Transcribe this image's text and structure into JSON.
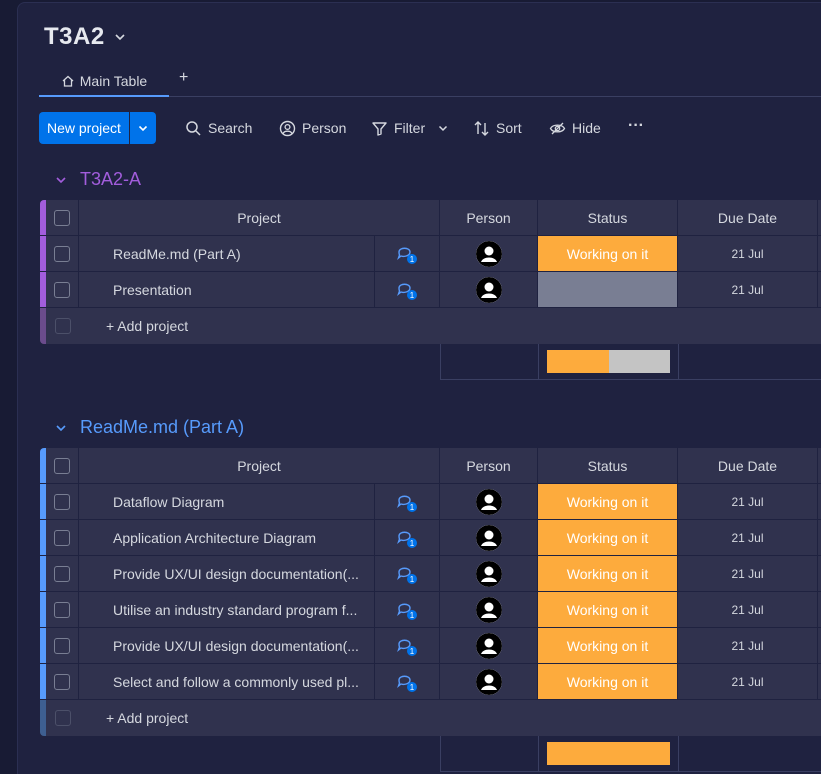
{
  "board": {
    "title": "T3A2",
    "tabs": [
      {
        "label": "Main Table",
        "icon": "home-icon"
      }
    ],
    "add_tab_label": "+"
  },
  "toolbar": {
    "new_project_label": "New project",
    "search_label": "Search",
    "person_label": "Person",
    "filter_label": "Filter",
    "sort_label": "Sort",
    "hide_label": "Hide",
    "more_label": "···"
  },
  "columns": {
    "project": "Project",
    "person": "Person",
    "status": "Status",
    "due_date": "Due Date"
  },
  "colors": {
    "group1": "#a25ddc",
    "group2": "#579bfc",
    "working": "#fdab3d",
    "empty_status": "#797e93",
    "summary_gray": "#c4c4c4"
  },
  "groups": [
    {
      "title": "T3A2-A",
      "color": "#a25ddc",
      "add_label": "+ Add project",
      "items": [
        {
          "name": "ReadMe.md (Part A)",
          "updates": "1",
          "status": "Working on it",
          "due": "21 Jul"
        },
        {
          "name": "Presentation",
          "updates": "1",
          "status": "",
          "due": "21 Jul"
        }
      ],
      "status_summary": [
        {
          "status": "Working on it",
          "fraction": 0.5
        },
        {
          "status": "",
          "fraction": 0.5
        }
      ]
    },
    {
      "title": "ReadMe.md (Part A)",
      "color": "#579bfc",
      "add_label": "+ Add project",
      "items": [
        {
          "name": "Dataflow Diagram",
          "updates": "1",
          "status": "Working on it",
          "due": "21 Jul"
        },
        {
          "name": "Application Architecture Diagram",
          "updates": "1",
          "status": "Working on it",
          "due": "21 Jul"
        },
        {
          "name": "Provide UX/UI design documentation(...",
          "updates": "1",
          "status": "Working on it",
          "due": "21 Jul"
        },
        {
          "name": "Utilise an industry standard program f...",
          "updates": "1",
          "status": "Working on it",
          "due": "21 Jul"
        },
        {
          "name": "Provide UX/UI design documentation(...",
          "updates": "1",
          "status": "Working on it",
          "due": "21 Jul"
        },
        {
          "name": "Select and follow a commonly used pl...",
          "updates": "1",
          "status": "Working on it",
          "due": "21 Jul"
        }
      ],
      "status_summary": [
        {
          "status": "Working on it",
          "fraction": 1.0
        }
      ]
    }
  ]
}
